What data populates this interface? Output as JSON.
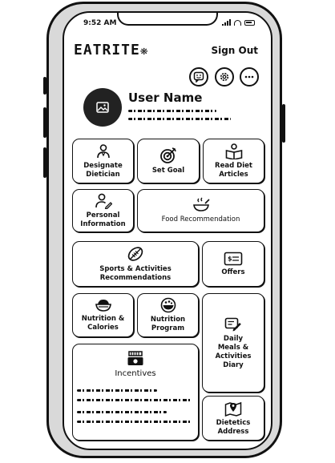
{
  "status_bar": {
    "time": "9:52 AM"
  },
  "header": {
    "logo": "EATRITE",
    "sign_out": "Sign Out"
  },
  "profile": {
    "user_name": "User Name"
  },
  "tiles": {
    "designate_dietician": "Designate\nDietician",
    "set_goal": "Set Goal",
    "read_diet_articles": "Read Diet\nArticles",
    "personal_information": "Personal\nInformation",
    "food_recommendation": "Food Recommendation",
    "sports_activities": "Sports & Activities\nRecommendations",
    "offers": "Offers",
    "nutrition_calories": "Nutrition &\nCalories",
    "nutrition_program": "Nutrition\nProgram",
    "daily_meals_diary": "Daily\nMeals &\nActivities\nDiary",
    "incentives": "Incentives",
    "dietetics_address": "Dietetics\nAddress"
  }
}
